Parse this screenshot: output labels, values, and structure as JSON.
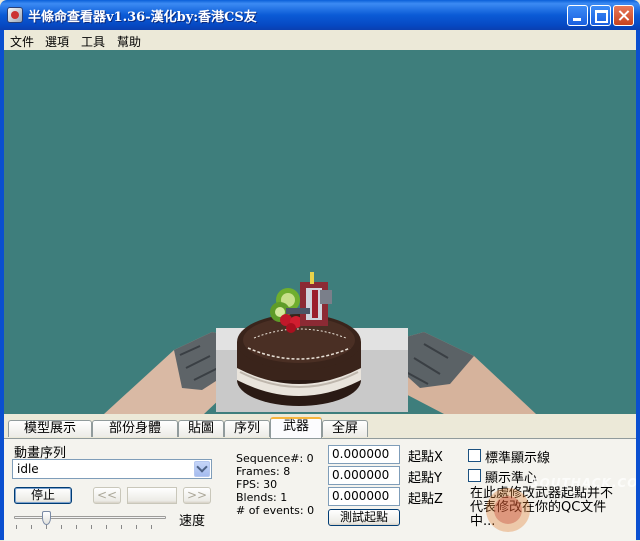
{
  "window": {
    "title": "半條命查看器v1.36-漢化by:香港CS友"
  },
  "menu": [
    "文件",
    "選項",
    "工具",
    "幫助"
  ],
  "tabs": [
    {
      "label": "模型展示",
      "active": false
    },
    {
      "label": "部份身體",
      "active": false
    },
    {
      "label": "貼圖",
      "active": false
    },
    {
      "label": "序列",
      "active": false
    },
    {
      "label": "武器",
      "active": true
    },
    {
      "label": "全屏",
      "active": false
    }
  ],
  "panel": {
    "sequence_label": "動畫序列",
    "sequence_value": "idle",
    "stop_button": "停止",
    "prev_button": "<<",
    "next_button": ">>",
    "speed_label": "速度",
    "speed": 0.2,
    "stats": {
      "sequence": "Sequence#: 0",
      "frames": "Frames: 8",
      "fps": "FPS: 30",
      "blends": "Blends: 1",
      "events": "# of events: 0"
    },
    "origin_x_value": "0.000000",
    "origin_y_value": "0.000000",
    "origin_z_value": "0.000000",
    "origin_x_label": "起點X",
    "origin_y_label": "起點Y",
    "origin_z_label": "起點Z",
    "test_origin_button": "測試起點",
    "show_guide_label": "標準顯示線",
    "show_crosshair_label": "顯示準心",
    "note": "在此處修改武器起點并不代表修改在你的QC文件中..."
  },
  "watermark": "SOUTHACK.COM",
  "colors": {
    "viewport_bg": "#3e7e7c",
    "title_bar": "#0b5bd6",
    "active_tab_accent": "#f7b53c"
  }
}
